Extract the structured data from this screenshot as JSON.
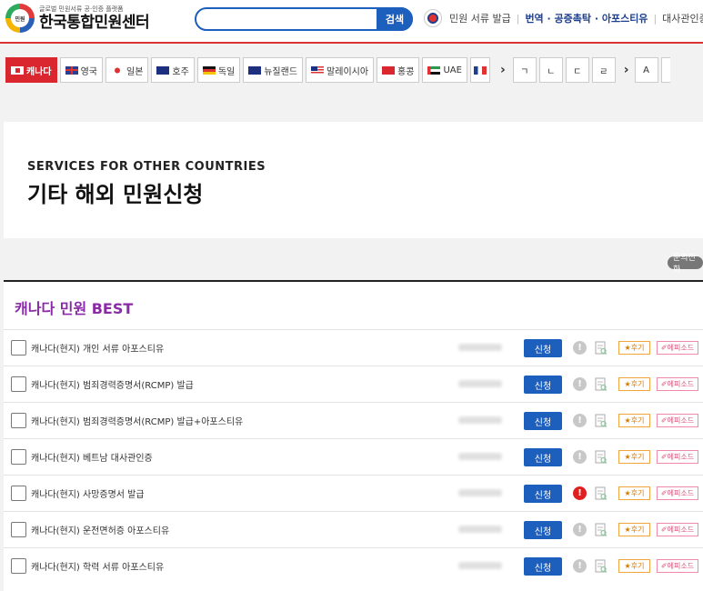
{
  "header": {
    "logo_badge": "민원",
    "logo_sub": "글로벌 민원서류 공·인증 플랫폼",
    "logo_main": "한국통합민원센터",
    "search_placeholder": "",
    "search_button": "검색",
    "links": [
      "민원 서류 발급",
      "번역 · 공증촉탁 · 아포스티유",
      "대사관인증"
    ]
  },
  "countries": [
    {
      "label": "캐나다",
      "active": true,
      "flag": "canada-flag-icon"
    },
    {
      "label": "영국",
      "active": false,
      "flag": "uk-flag-icon"
    },
    {
      "label": "일본",
      "active": false,
      "flag": "japan-flag-icon"
    },
    {
      "label": "호주",
      "active": false,
      "flag": "australia-flag-icon"
    },
    {
      "label": "독일",
      "active": false,
      "flag": "germany-flag-icon"
    },
    {
      "label": "뉴질랜드",
      "active": false,
      "flag": "newzealand-flag-icon"
    },
    {
      "label": "말레이시아",
      "active": false,
      "flag": "malaysia-flag-icon"
    },
    {
      "label": "홍콩",
      "active": false,
      "flag": "hongkong-flag-icon"
    },
    {
      "label": "UAE",
      "active": false,
      "flag": "uae-flag-icon"
    }
  ],
  "letters": [
    "ㄱ",
    "ㄴ",
    "ㄷ",
    "ㄹ",
    "A"
  ],
  "banner": {
    "english": "SERVICES FOR OTHER COUNTRIES",
    "korean": "기타 해외 민원신청"
  },
  "inquiry_badge": "문의전화",
  "best": {
    "title": "캐나다 민원 BEST",
    "apply_label": "신청",
    "review_label": "★후기",
    "episode_label": "✐에피소드",
    "items": [
      {
        "label": "캐나다(현지) 개인 서류 아포스티유",
        "alert": false
      },
      {
        "label": "캐나다(현지) 범죄경력증명서(RCMP) 발급",
        "alert": false
      },
      {
        "label": "캐나다(현지) 범죄경력증명서(RCMP) 발급+아포스티유",
        "alert": false
      },
      {
        "label": "캐나다(현지) 베트남 대사관인증",
        "alert": false
      },
      {
        "label": "캐나다(현지) 사망증명서 발급",
        "alert": true
      },
      {
        "label": "캐나다(현지) 운전면허증 아포스티유",
        "alert": false
      },
      {
        "label": "캐나다(현지) 학력 서류 아포스티유",
        "alert": false
      }
    ]
  },
  "colors": {
    "brand_blue": "#1d5fbd",
    "active_red": "#d9262f",
    "best_title": "#8a2aa6"
  }
}
